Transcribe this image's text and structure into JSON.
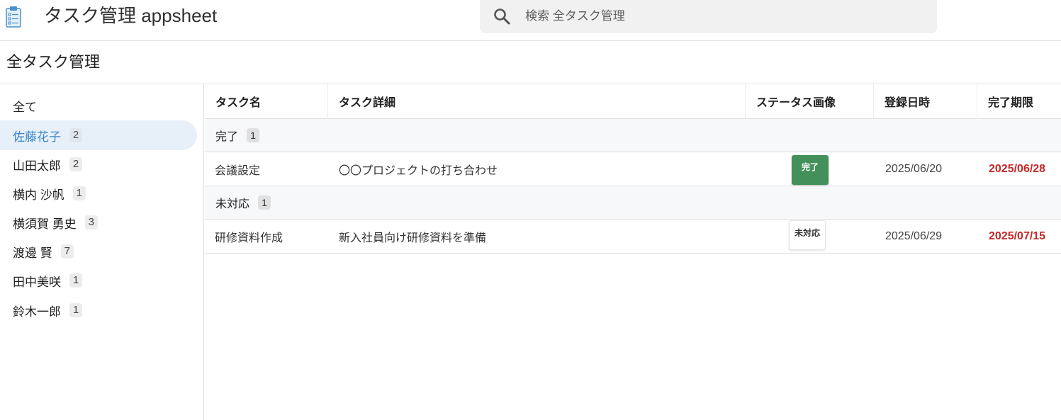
{
  "header": {
    "app_title": "タスク管理 appsheet",
    "search_placeholder": "検索 全タスク管理"
  },
  "page": {
    "title": "全タスク管理"
  },
  "sidebar": {
    "items": [
      {
        "label": "全て",
        "count": ""
      },
      {
        "label": "佐藤花子",
        "count": "2",
        "active": true
      },
      {
        "label": "山田太郎",
        "count": "2"
      },
      {
        "label": "横内 沙帆",
        "count": "1"
      },
      {
        "label": "横須賀 勇史",
        "count": "3"
      },
      {
        "label": "渡邊 賢",
        "count": "7"
      },
      {
        "label": "田中美咲",
        "count": "1"
      },
      {
        "label": "鈴木一郎",
        "count": "1"
      }
    ]
  },
  "table": {
    "columns": [
      "タスク名",
      "タスク詳細",
      "ステータス画像",
      "登録日時",
      "完了期限"
    ],
    "groups": [
      {
        "label": "完了",
        "count": "1",
        "rows": [
          {
            "name": "会議設定",
            "detail": "〇〇プロジェクトの打ち合わせ",
            "status": "完了",
            "registered": "2025/06/20",
            "due": "2025/06/28"
          }
        ]
      },
      {
        "label": "未対応",
        "count": "1",
        "rows": [
          {
            "name": "研修資料作成",
            "detail": "新入社員向け研修資料を準備",
            "status": "未対応",
            "registered": "2025/06/29",
            "due": "2025/07/15"
          }
        ]
      }
    ]
  },
  "colors": {
    "accent": "#3a85c8",
    "active_bg": "#e7f0f9",
    "due_red": "#c62828",
    "status_done_green": "#43905a"
  },
  "icons": {
    "app": "clipboard-icon",
    "search": "search-icon"
  }
}
